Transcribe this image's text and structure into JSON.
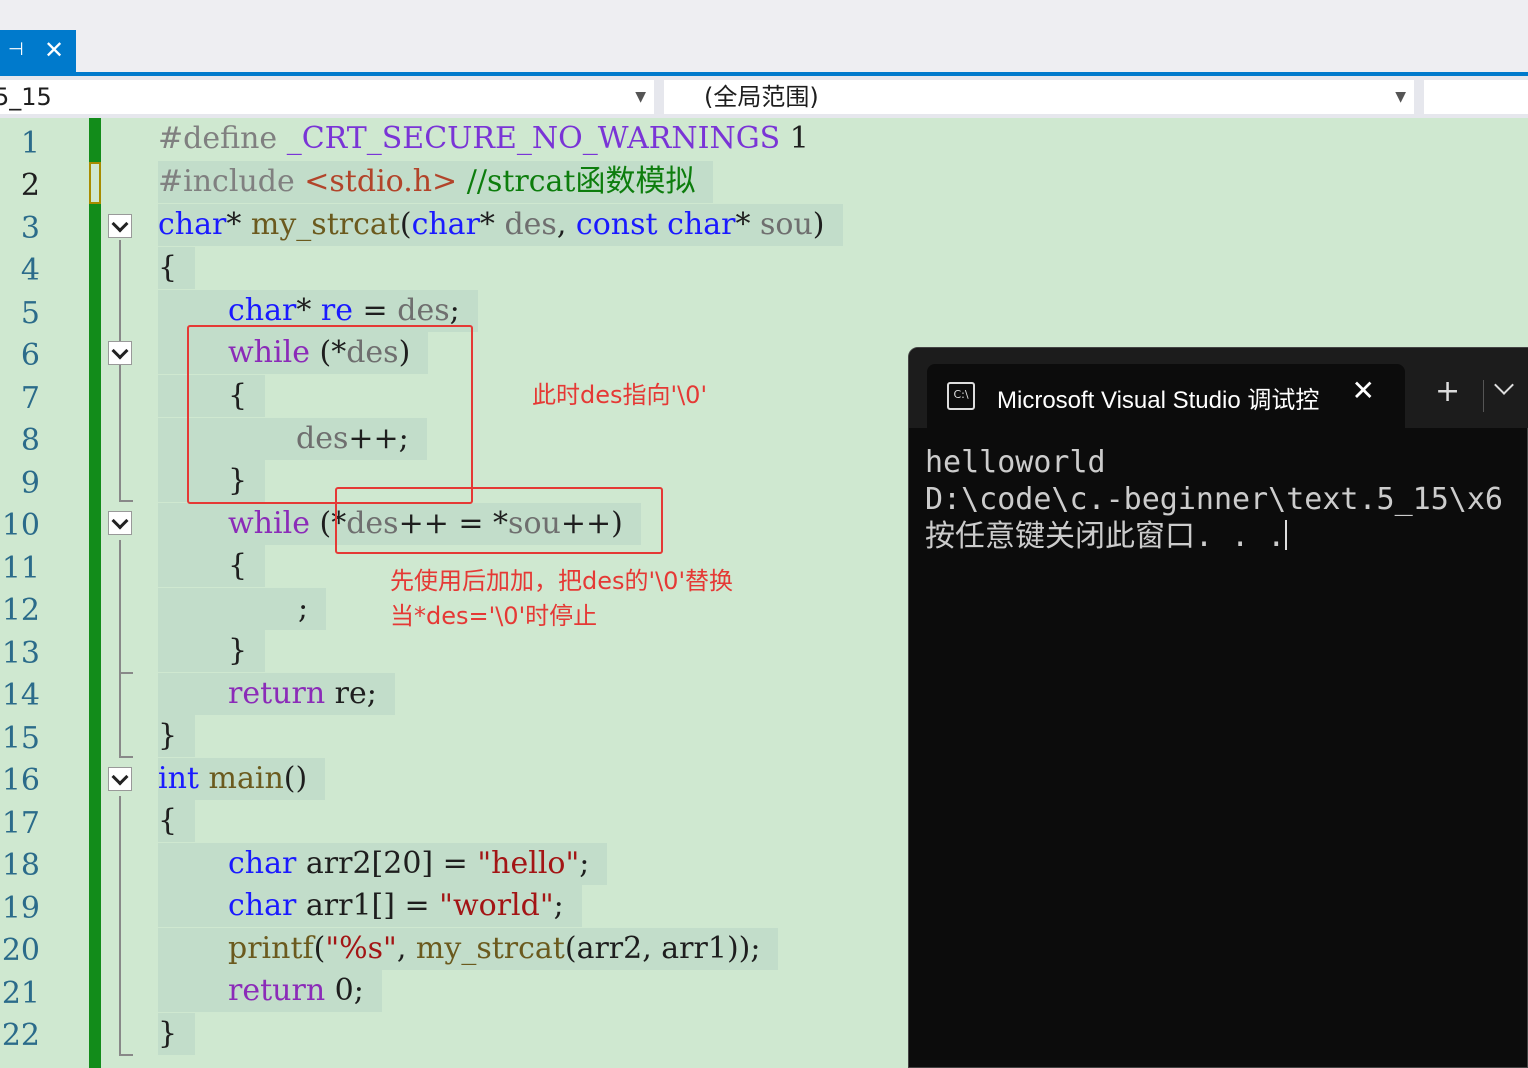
{
  "editor": {
    "nav": {
      "file_combo": "5_15",
      "scope_combo": "(全局范围)"
    },
    "line_numbers": [
      "1",
      "2",
      "3",
      "4",
      "5",
      "6",
      "7",
      "8",
      "9",
      "10",
      "11",
      "12",
      "13",
      "14",
      "15",
      "16",
      "17",
      "18",
      "19",
      "20",
      "21",
      "22"
    ],
    "current_line": "2",
    "code": {
      "l1_pp": "#define",
      "l1_macro": " _CRT_SECURE_NO_WARNINGS",
      "l1_val": " 1",
      "l2_pp": "#include",
      "l2_hdr": " <stdio.h>",
      "l2_cm": " //strcat函数模拟",
      "l3_kw1": "char",
      "l3_a": "* ",
      "l3_fn": "my_strcat",
      "l3_b": "(",
      "l3_kw2": "char",
      "l3_c": "* ",
      "l3_v1": "des",
      "l3_d": ", ",
      "l3_kw3": "const",
      "l3_e": " ",
      "l3_kw4": "char",
      "l3_f": "* ",
      "l3_v2": "sou",
      "l3_g": ")",
      "l4": "{",
      "l5_kw": "char",
      "l5_a": "* ",
      "l5_var": "re",
      "l5_b": " = ",
      "l5_v": "des",
      "l5_c": ";",
      "l6_kw": "while",
      "l6_a": " (*",
      "l6_v": "des",
      "l6_b": ")",
      "l7": "{",
      "l8_v": "des",
      "l8_a": "++;",
      "l9": "}",
      "l10_kw": "while",
      "l10_a": " (*",
      "l10_v1": "des",
      "l10_b": "++ = *",
      "l10_v2": "sou",
      "l10_c": "++)",
      "l11": "{",
      "l12": ";",
      "l13": "}",
      "l14_kw": "return",
      "l14_a": " re;",
      "l15": "}",
      "l16_kw": "int",
      "l16_fn": " main",
      "l16_a": "()",
      "l17": "{",
      "l18_kw": "char",
      "l18_a": " arr2[20] = ",
      "l18_str": "\"hello\"",
      "l18_b": ";",
      "l19_kw": "char",
      "l19_a": " arr1[] = ",
      "l19_str": "\"world\"",
      "l19_b": ";",
      "l20_fn": "printf",
      "l20_a": "(",
      "l20_str": "\"%s\"",
      "l20_b": ", ",
      "l20_fn2": "my_strcat",
      "l20_c": "(arr2, arr1));",
      "l21_kw": "return",
      "l21_a": " 0;",
      "l22": "}"
    },
    "annotations": {
      "note1": "此时des指向'\\0'",
      "note2_line1": "先使用后加加，把des的'\\0'替换",
      "note2_line2": "当*des='\\0'时停止"
    }
  },
  "console": {
    "tab_title": "Microsoft Visual Studio 调试控",
    "icon_label": "C:\\",
    "output": [
      "helloworld",
      "D:\\code\\c.-beginner\\text.5_15\\x6",
      "按任意键关闭此窗口. . ."
    ]
  },
  "colors": {
    "editor_bg": "#cfe8d0",
    "accent": "#007acc",
    "annotation": "#e53935",
    "console_bg": "#0c0c0c"
  }
}
